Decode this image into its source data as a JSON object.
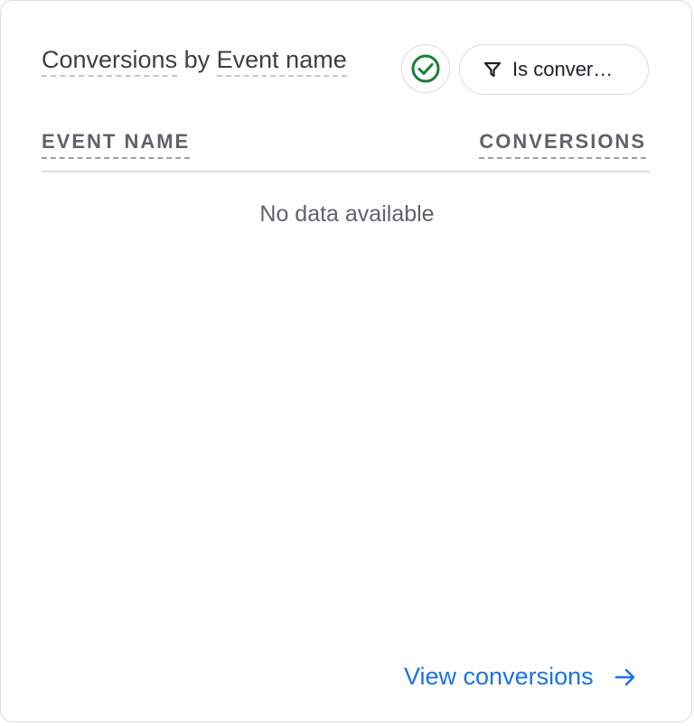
{
  "card": {
    "title_prefix": "Conversions",
    "title_joiner": "by",
    "title_dimension": "Event name",
    "status_icon": "check-circle-icon",
    "filter_chip_label": "Is conver…",
    "filter_icon": "filter-icon"
  },
  "table": {
    "columns": [
      "EVENT NAME",
      "CONVERSIONS"
    ],
    "empty_message": "No data available"
  },
  "footer": {
    "link_label": "View conversions",
    "link_icon": "arrow-right-icon"
  },
  "colors": {
    "status_green": "#188038",
    "link_blue": "#1a73e8"
  }
}
